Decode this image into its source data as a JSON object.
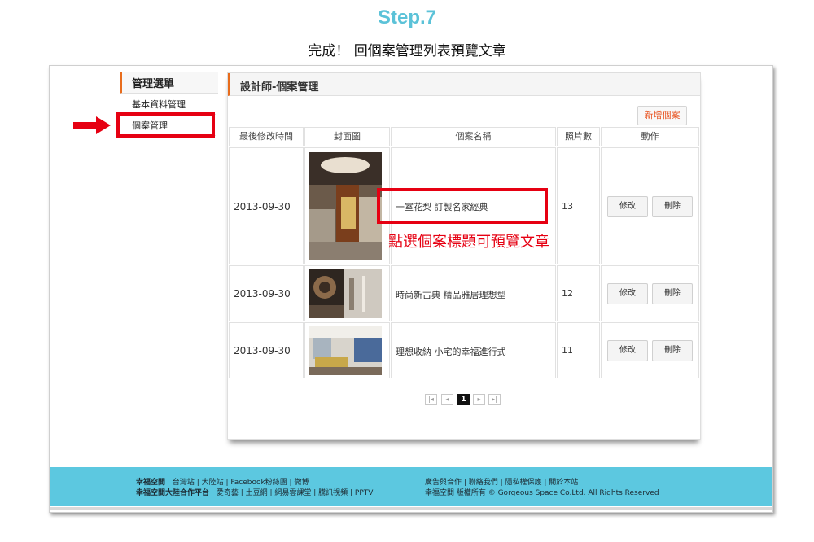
{
  "step": {
    "title": "Step.7",
    "subtitle": "完成！ 回個案管理列表預覽文章"
  },
  "sidebar": {
    "header": "管理選單",
    "items": [
      {
        "label": "基本資料管理"
      },
      {
        "label": "個案管理"
      }
    ]
  },
  "main": {
    "title": "設計師-個案管理",
    "add_button": "新增個案",
    "columns": [
      "最後修改時間",
      "封面圖",
      "個案名稱",
      "照片數",
      "動作"
    ],
    "rows": [
      {
        "date": "2013-09-30",
        "name": "一室花梨 訂製名家經典",
        "photos": "13",
        "edit": "修改",
        "delete": "刪除"
      },
      {
        "date": "2013-09-30",
        "name": "時尚新古典 精品雅居理想型",
        "photos": "12",
        "edit": "修改",
        "delete": "刪除"
      },
      {
        "date": "2013-09-30",
        "name": "理想收納 小宅的幸福進行式",
        "photos": "11",
        "edit": "修改",
        "delete": "刪除"
      }
    ],
    "annotation": "點選個案標題可預覽文章",
    "pagination": {
      "first": "|◂",
      "prev": "◂",
      "current": "1",
      "next": "▸",
      "last": "▸|"
    }
  },
  "footer": {
    "line1_brand": "幸福空間",
    "line1_links": "台灣站 | 大陸站 | Facebook粉絲團 | 微博",
    "line2_brand": "幸福空間大陸合作平台",
    "line2_links": "愛奇藝 | 土豆網 | 網易雲課堂 | 騰訊視頻 | PPTV",
    "right_line1": "廣告與合作 | 聯絡我們 | 隱私權保護 | 關於本站",
    "right_line2": "幸福空間  版權所有 © Gorgeous Space Co.Ltd. All Rights Reserved"
  },
  "colors": {
    "accent": "#e86c1c",
    "annotation_red": "#e60012",
    "footer_bg": "#5cc8e0",
    "step_title": "#5bc2d8"
  }
}
